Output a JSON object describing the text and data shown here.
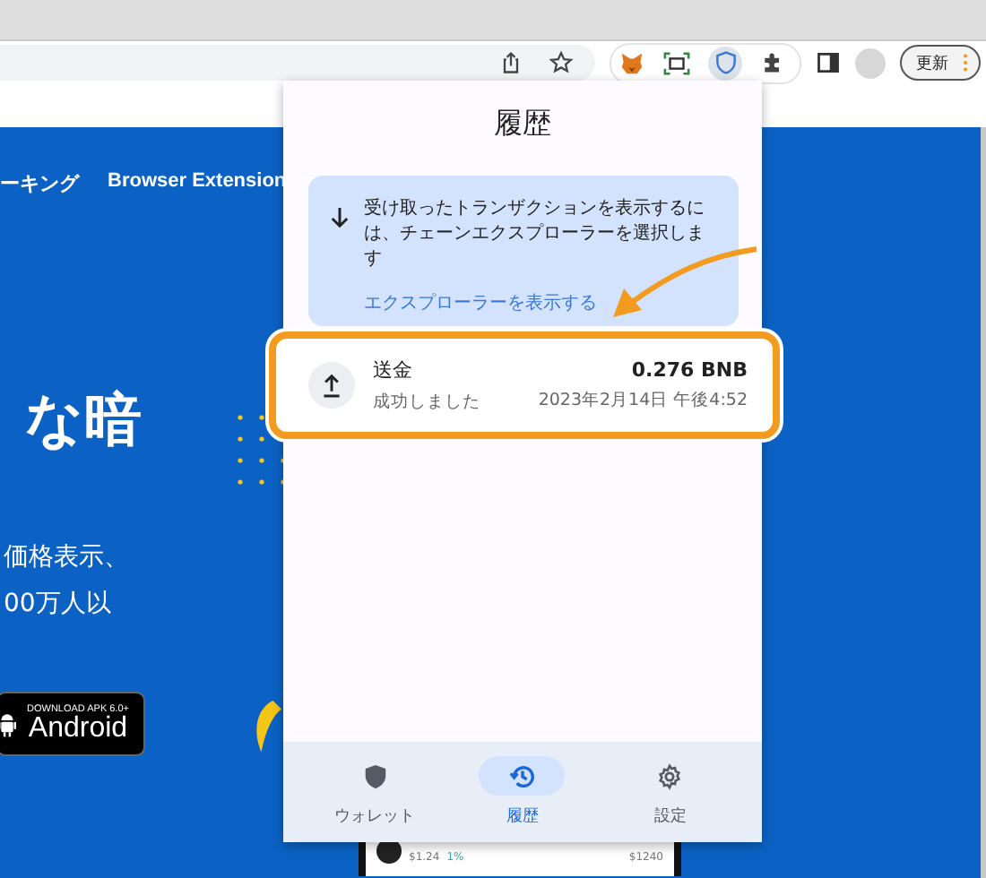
{
  "browser": {
    "update_button": "更新"
  },
  "page": {
    "nav": [
      "ーキング",
      "Browser Extension"
    ],
    "headline": "な暗",
    "body_lines": [
      "価格表示、",
      "00万人以"
    ],
    "android_button": {
      "caption": "DOWNLOAD APK 6.0+",
      "label": "Android"
    },
    "phone": {
      "price": "$1.24",
      "change": "1%",
      "value": "$1240"
    }
  },
  "popup": {
    "title": "履歴",
    "notice": {
      "text": "受け取ったトランザクションを表示するには、チェーンエクスプローラーを選択します",
      "link": "エクスプローラーを表示する"
    },
    "transactions": [
      {
        "kind": "send",
        "title": "送金",
        "status": "成功しました",
        "amount": "0.276 BNB",
        "date": "2023年2月14日 午後4:52",
        "highlighted": true
      }
    ],
    "nav": [
      {
        "kind": "wallet",
        "label": "ウォレット",
        "selected": false
      },
      {
        "kind": "history",
        "label": "履歴",
        "selected": true
      },
      {
        "kind": "settings",
        "label": "設定",
        "selected": false
      }
    ]
  }
}
